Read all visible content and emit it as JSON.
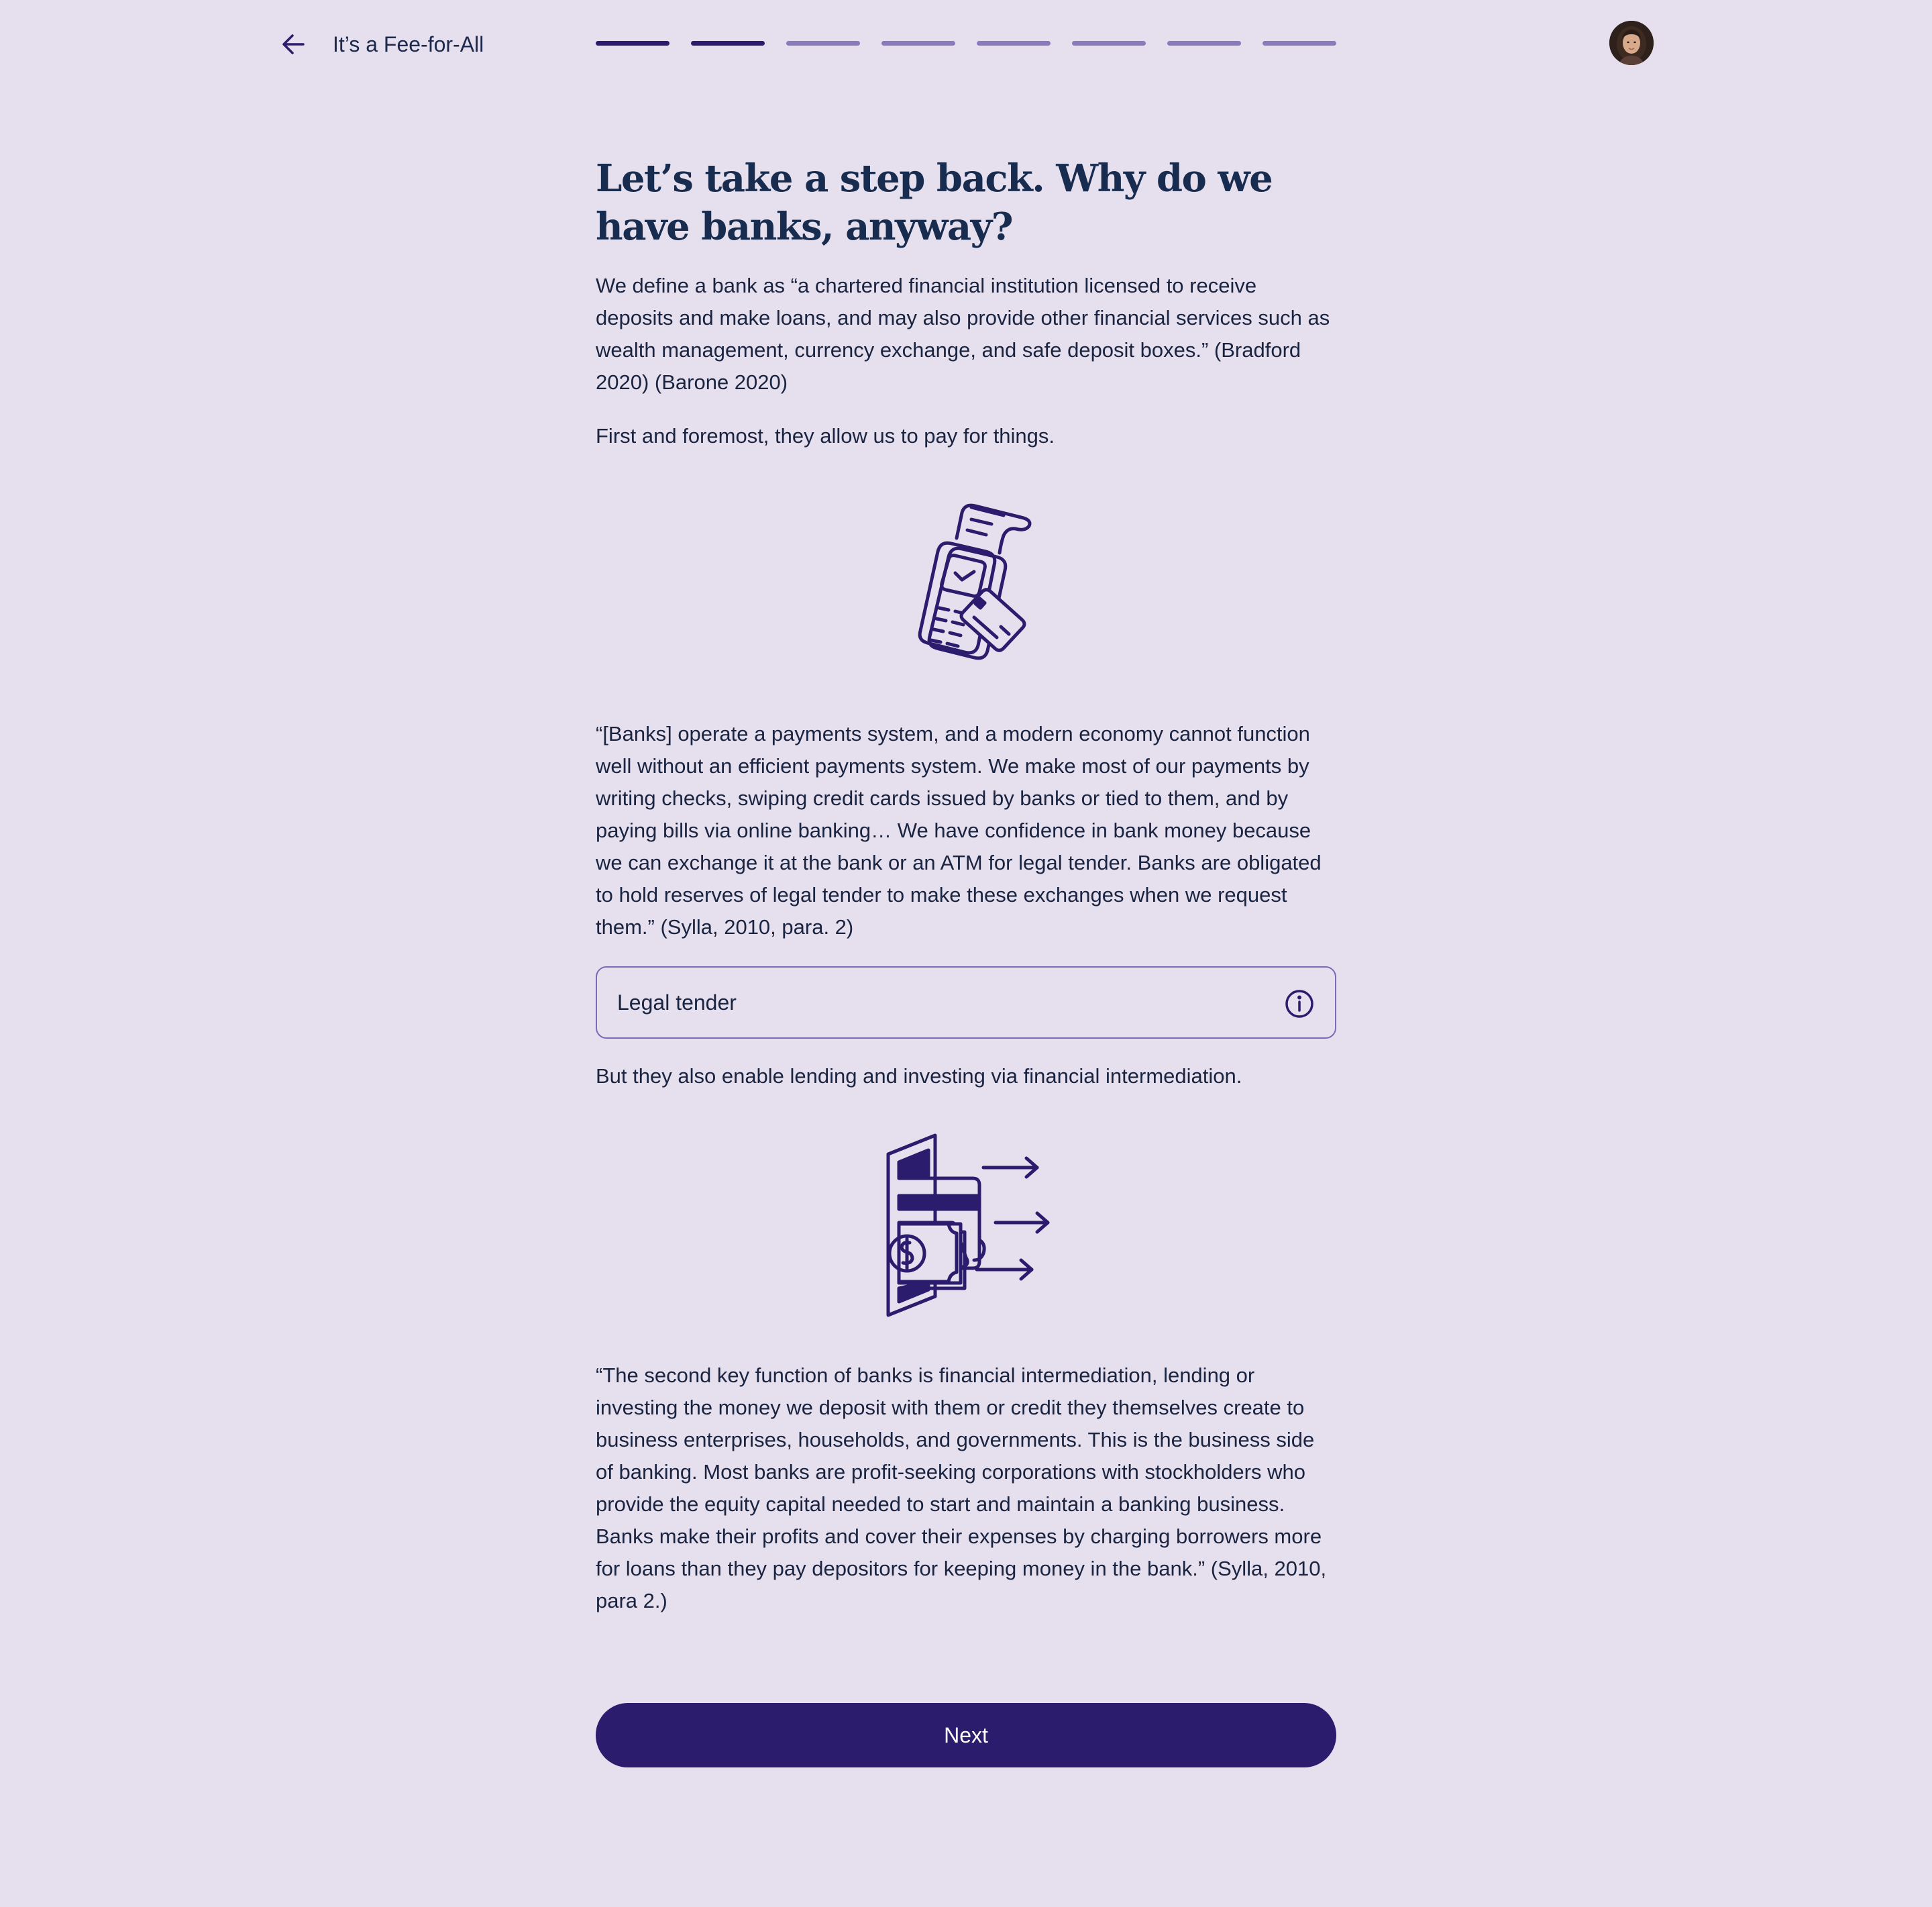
{
  "header": {
    "back_icon": "arrow-left-icon",
    "title": "It’s a Fee-for-All",
    "progress": {
      "total_steps": 8,
      "completed_steps": 2
    },
    "avatar_icon": "user-avatar"
  },
  "content": {
    "heading": "Let’s take a step back. Why do we have banks, anyway?",
    "definition": "We define a bank as “a chartered financial institution licensed to receive deposits and make loans, and may also provide other financial services such as wealth management, currency exchange, and safe deposit boxes.” (Bradford 2020) (Barone 2020)",
    "first_point": "First and foremost, they allow us to pay for things.",
    "illustration_1": "payment-terminal-icon",
    "quote_1": "“[Banks] operate a payments system, and a modern economy cannot function well without an efficient payments system. We make most of our payments by writing checks, swiping credit cards issued by banks or tied to them, and by paying bills via online banking… We have confidence in bank money because we can exchange it at the bank or an ATM for legal tender. Banks are obligated to hold reserves of legal tender to make these exchanges when we request them.” (Sylla, 2010, para. 2)",
    "term": {
      "label": "Legal tender",
      "icon": "info-icon"
    },
    "second_point": "But they also enable lending and investing via financial intermediation.",
    "illustration_2": "wallet-money-out-icon",
    "quote_2": "“The second key function of banks is financial intermediation, lending or investing the money we deposit with them or credit they themselves create to business enterprises, households, and governments. This is the business side of banking. Most banks are profit-seeking corporations with stockholders who provide the equity capital needed to start and maintain a banking business. Banks make their profits and cover their expenses by charging borrowers more for loans than they pay depositors for keeping money in the bank.” (Sylla, 2010, para 2.)"
  },
  "footer": {
    "next_label": "Next"
  },
  "colors": {
    "background": "#e5dfee",
    "primary": "#2b1c6d",
    "progress_inactive": "#8a7abd",
    "heading": "#182c4f",
    "text": "#1a2440",
    "border": "#7c6cb5"
  }
}
